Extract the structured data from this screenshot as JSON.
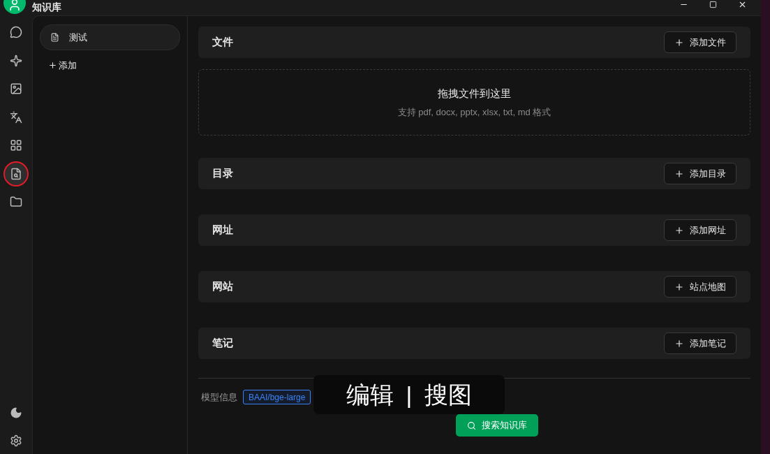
{
  "window": {
    "title": "知识库"
  },
  "nav": [
    {
      "selected": false
    },
    {
      "selected": false
    },
    {
      "selected": false
    },
    {
      "selected": false
    },
    {
      "selected": false
    },
    {
      "selected": true
    },
    {
      "selected": false
    }
  ],
  "bases": [
    {
      "name": "测试",
      "selected": true
    }
  ],
  "add_base": "添加",
  "sections": [
    {
      "title": "文件",
      "button": "添加文件",
      "dropzone": {
        "title": "拖拽文件到这里",
        "hint": "支持 pdf, docx, pptx, xlsx, txt, md 格式"
      }
    },
    {
      "title": "目录",
      "button": "添加目录"
    },
    {
      "title": "网址",
      "button": "添加网址"
    },
    {
      "title": "网站",
      "button": "站点地图"
    },
    {
      "title": "笔记",
      "button": "添加笔记"
    }
  ],
  "model_info": {
    "label": "模型信息",
    "tags": [
      {
        "text": "BAAI/bge-large",
        "color": "#3b82f6"
      }
    ]
  },
  "search_button": "搜索知识库",
  "overlay": {
    "items": [
      "编辑",
      "|",
      "搜图"
    ]
  }
}
